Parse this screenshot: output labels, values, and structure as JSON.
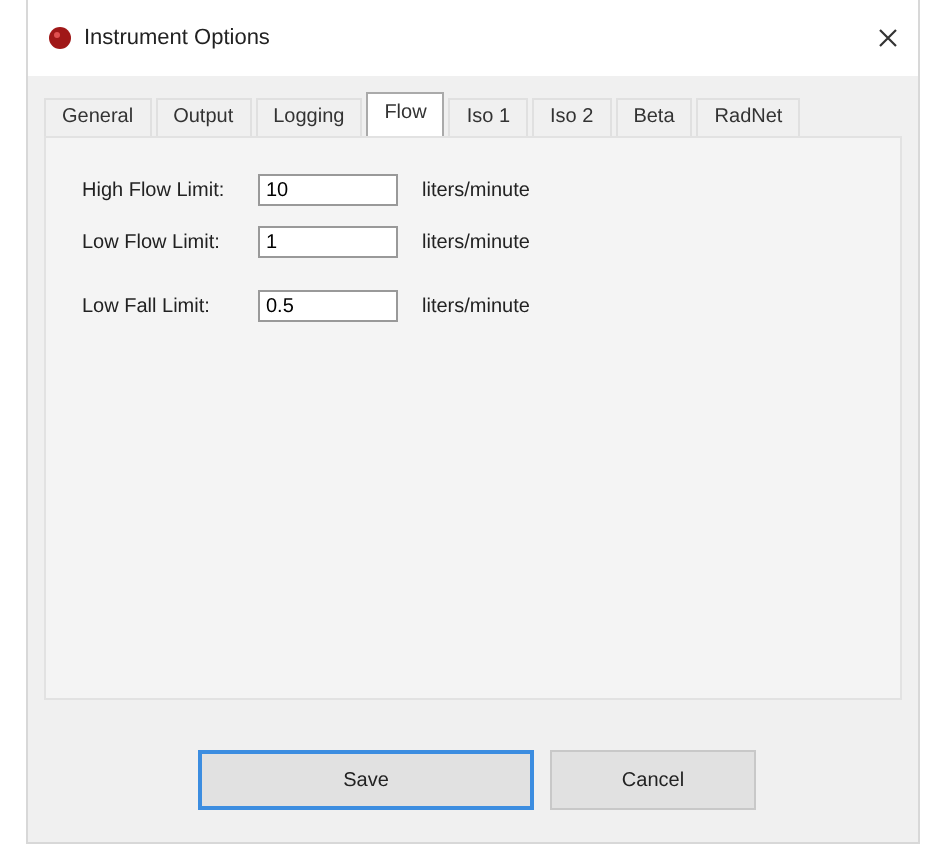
{
  "window": {
    "title": "Instrument Options"
  },
  "tabs": [
    {
      "label": "General",
      "selected": false
    },
    {
      "label": "Output",
      "selected": false
    },
    {
      "label": "Logging",
      "selected": false
    },
    {
      "label": "Flow",
      "selected": true
    },
    {
      "label": "Iso 1",
      "selected": false
    },
    {
      "label": "Iso 2",
      "selected": false
    },
    {
      "label": "Beta",
      "selected": false
    },
    {
      "label": "RadNet",
      "selected": false
    }
  ],
  "fields": [
    {
      "label": "High Flow Limit:",
      "value": "10",
      "unit": "liters/minute"
    },
    {
      "label": "Low Flow Limit:",
      "value": "1",
      "unit": "liters/minute"
    },
    {
      "label": "Low Fall Limit:",
      "value": "0.5",
      "unit": "liters/minute"
    }
  ],
  "buttons": [
    {
      "label": "Save",
      "selected": true
    },
    {
      "label": "Cancel",
      "selected": false
    }
  ]
}
